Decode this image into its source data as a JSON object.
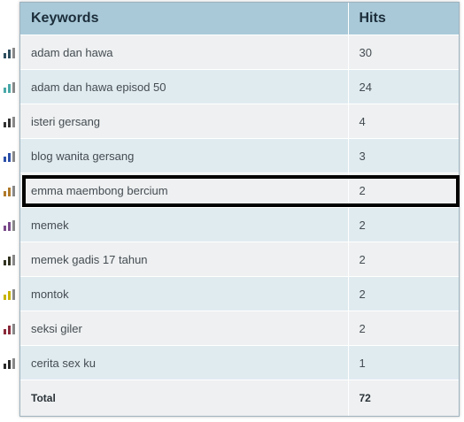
{
  "table": {
    "headers": {
      "keywords": "Keywords",
      "hits": "Hits"
    },
    "rows": [
      {
        "keyword": "adam dan hawa",
        "hits": "30",
        "icon_color": "#2f4f5f"
      },
      {
        "keyword": "adam dan hawa episod 50",
        "hits": "24",
        "icon_color": "#4aa8a8"
      },
      {
        "keyword": "isteri gersang",
        "hits": "4",
        "icon_color": "#333333"
      },
      {
        "keyword": "blog wanita gersang",
        "hits": "3",
        "icon_color": "#2b4fa8"
      },
      {
        "keyword": "emma maembong bercium",
        "hits": "2",
        "icon_color": "#b07a2a"
      },
      {
        "keyword": "memek",
        "hits": "2",
        "icon_color": "#7a4a8a"
      },
      {
        "keyword": "memek gadis 17 tahun",
        "hits": "2",
        "icon_color": "#333322"
      },
      {
        "keyword": "montok",
        "hits": "2",
        "icon_color": "#c8b400"
      },
      {
        "keyword": "seksi giler",
        "hits": "2",
        "icon_color": "#8a2a3a"
      },
      {
        "keyword": "cerita sex ku",
        "hits": "1",
        "icon_color": "#2a2a2a"
      }
    ],
    "total": {
      "label": "Total",
      "hits": "72"
    },
    "highlighted_row": "emma maembong bercium"
  },
  "colors": {
    "header_bg": "#a9c9d8",
    "row_odd": "#eef0f1",
    "row_even": "#e0ebf0",
    "highlight_border": "#000000"
  }
}
